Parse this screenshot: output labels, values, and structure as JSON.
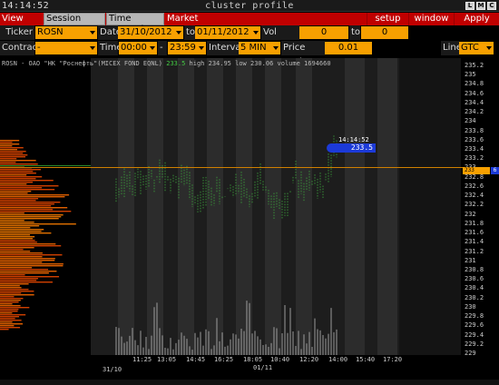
{
  "window": {
    "clock": "14:14:52",
    "title": "cluster profile",
    "controls": [
      "L",
      "M",
      "C"
    ]
  },
  "menu": {
    "items": [
      "View DOM",
      "Session Hours",
      "Time Interval",
      "Market Watch"
    ],
    "right_items": [
      "setup",
      "window",
      "Apply"
    ]
  },
  "toolbar1": {
    "ticker_label": "Ticker",
    "ticker_value": "ROSN",
    "date_label": "Date",
    "date_from": "31/10/2012",
    "to_label": "to",
    "date_to": "01/11/2012",
    "vol_range_label": "Vol range",
    "vol_from": "0",
    "vol_to_label": "to",
    "vol_to": "0"
  },
  "toolbar2": {
    "contract_label": "Contract",
    "contract_value": "-",
    "time_label": "Time",
    "time_from": "00:00",
    "time_to_label": "-",
    "time_to": "23:59",
    "interval_label": "Interval",
    "interval_value": "5 MIN",
    "price_scale_label": "Price Scale",
    "price_scale_value": "0.01",
    "line_label": "Line",
    "line_value": "GTC"
  },
  "chart": {
    "instrument": "ROSN - OAO \"НК \"Роснефть\"(MICEX FOND EQNL)",
    "last": "233.5",
    "high_label": "high",
    "high": "234.95",
    "low_label": "low",
    "low": "230.06",
    "volume_label": "volume",
    "volume": "1694660",
    "cursor_time": "14:14:52",
    "cursor_price": "233.5",
    "last_price_marker": "233",
    "last_price_badge": "6",
    "y_ticks": [
      "235.2",
      "235",
      "234.8",
      "234.6",
      "234.4",
      "234.2",
      "234",
      "233.8",
      "233.6",
      "233.4",
      "233.2",
      "233",
      "232.8",
      "232.6",
      "232.4",
      "232.2",
      "232",
      "231.8",
      "231.6",
      "231.4",
      "231.2",
      "231",
      "230.8",
      "230.6",
      "230.4",
      "230.2",
      "230",
      "229.8",
      "229.6",
      "229.4",
      "229.2",
      "229"
    ],
    "x_ticks": [
      "11:25",
      "13:05",
      "14:45",
      "16:25",
      "18:05",
      "10:40",
      "12:20",
      "14:00",
      "15:40",
      "17:20"
    ],
    "date_labels": [
      "31/10",
      "01/11"
    ],
    "colors": {
      "accent": "#f7a000",
      "menu": "#c00000",
      "cursor": "#1c3ad8",
      "price_line": "#d08000",
      "candles": "#3a9a3a"
    }
  }
}
